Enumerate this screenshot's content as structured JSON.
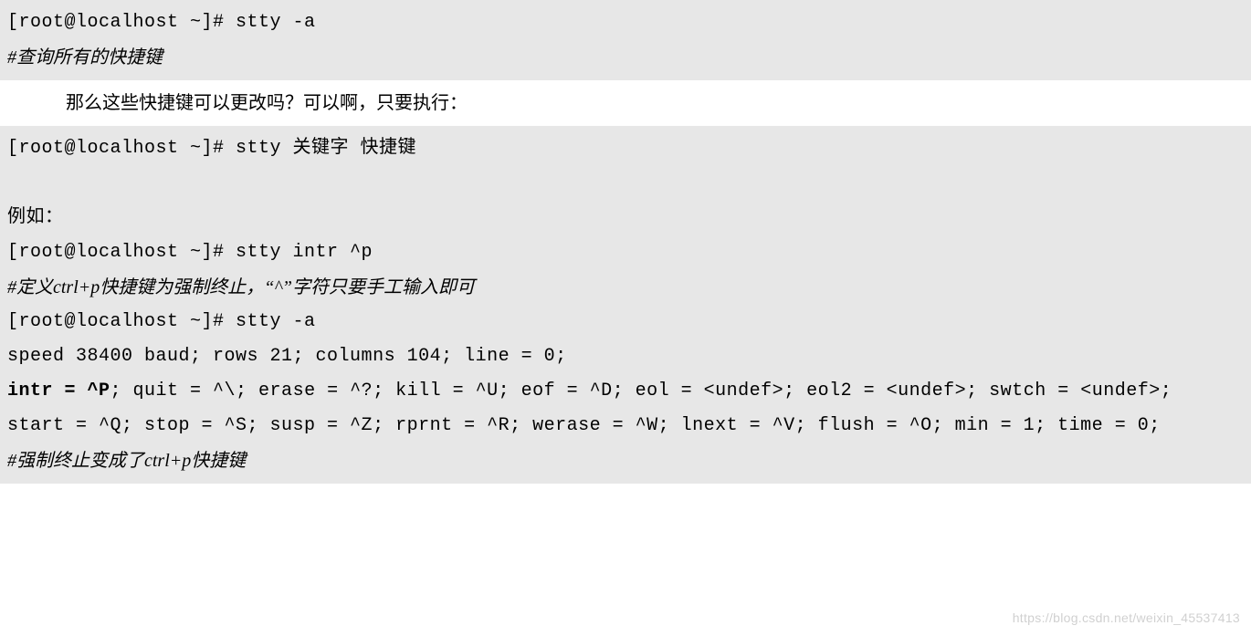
{
  "block1": {
    "line1": "[root@localhost ~]# stty -a",
    "line2": "#查询所有的快捷键"
  },
  "narrative1": "那么这些快捷键可以更改吗？可以啊，只要执行：",
  "block2": {
    "line1": "[root@localhost ~]# stty 关键字 快捷键",
    "blank": " ",
    "line2": "例如：",
    "line3": "[root@localhost ~]# stty intr ^p",
    "line4": "#定义ctrl+p快捷键为强制终止，“^”字符只要手工输入即可",
    "line5": "[root@localhost ~]# stty -a",
    "line6": "speed 38400 baud; rows 21; columns 104; line = 0;",
    "line7a": "intr = ^P",
    "line7b": "; quit = ^\\; erase = ^?; kill = ^U; eof = ^D; eol = <undef>; eol2 = <undef>; swtch = <undef>;",
    "line8": "start = ^Q; stop = ^S; susp = ^Z; rprnt = ^R; werase = ^W; lnext = ^V; flush = ^O; min = 1; time = 0;",
    "line9": "#强制终止变成了ctrl+p快捷键"
  },
  "watermark": "https://blog.csdn.net/weixin_45537413"
}
